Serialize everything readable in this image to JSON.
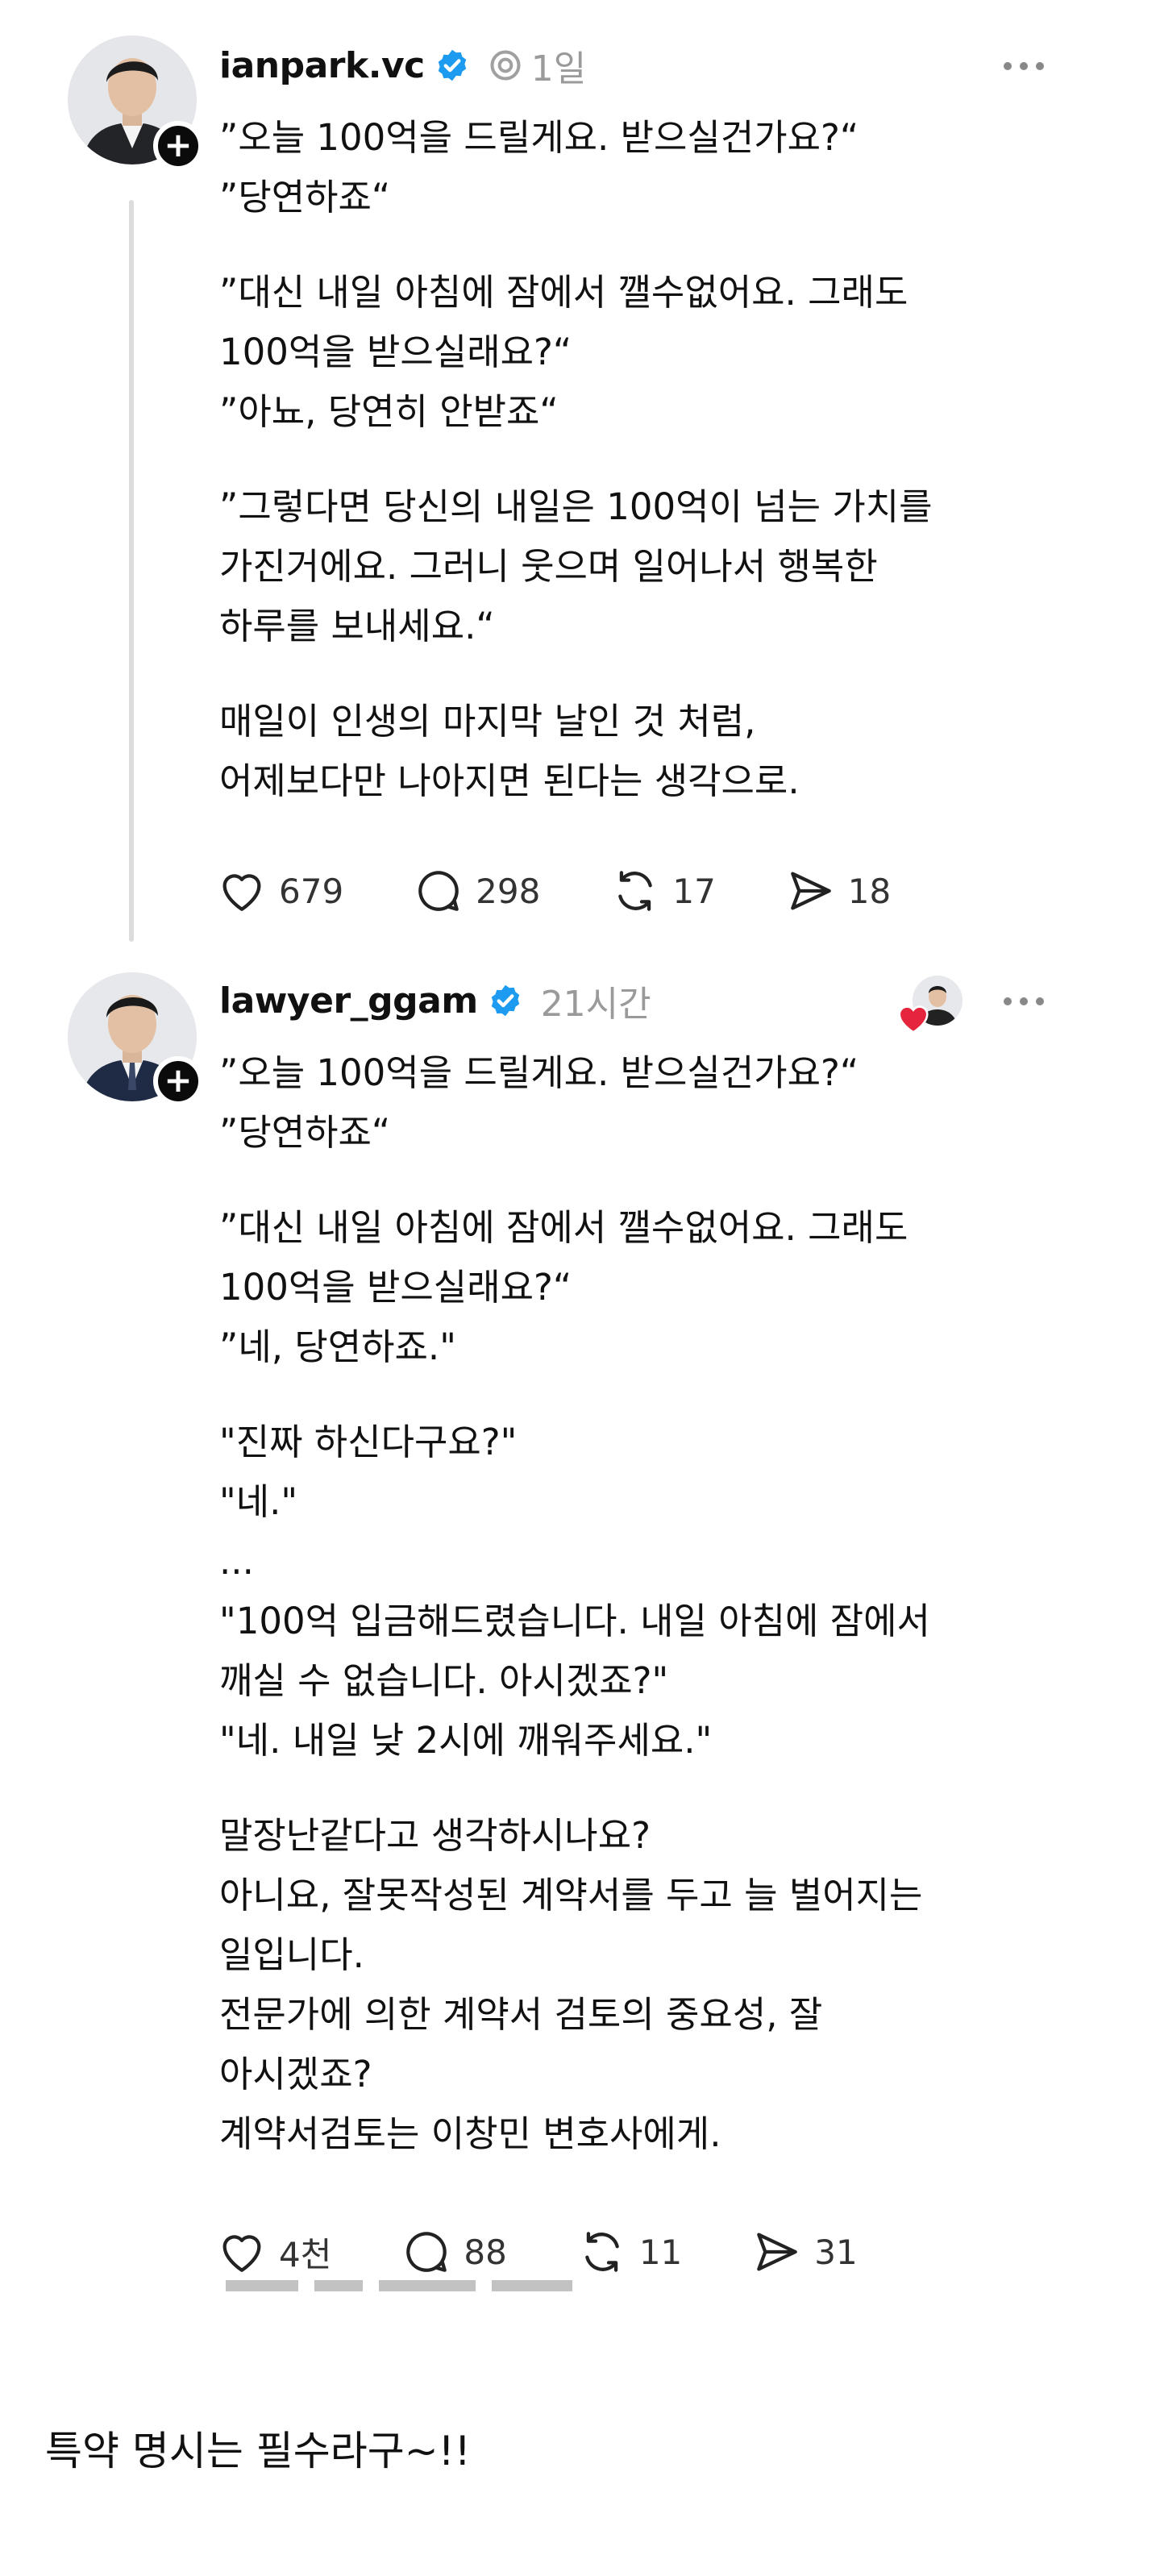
{
  "posts": [
    {
      "username": "ianpark.vc",
      "time": "1일",
      "paragraphs": [
        "”오늘 100억을 드릴게요. 받으실건가요?“\n”당연하죠“",
        "”대신 내일 아침에 잠에서 깰수없어요. 그래도\n100억을 받으실래요?“\n”아뇨, 당연히 안받죠“",
        "”그렇다면 당신의 내일은 100억이 넘는 가치를\n가진거에요. 그러니 웃으며 일어나서 행복한\n하루를 보내세요.“",
        "매일이 인생의 마지막 날인 것 처럼,\n어제보다만 나아지면 된다는 생각으로."
      ],
      "likes": "679",
      "replies": "298",
      "reposts": "17",
      "shares": "18"
    },
    {
      "username": "lawyer_ggam",
      "time": "21시간",
      "paragraphs": [
        "”오늘 100억을 드릴게요. 받으실건가요?“\n”당연하죠“",
        "”대신 내일 아침에 잠에서 깰수없어요. 그래도\n100억을 받으실래요?“\n”네, 당연하죠.\"",
        "\"진짜 하신다구요?\"\n\"네.\"\n...\n\"100억 입금해드렸습니다. 내일 아침에 잠에서\n깨실 수 없습니다. 아시겠죠?\"\n\"네. 내일 낮 2시에 깨워주세요.\"",
        "말장난같다고 생각하시나요?\n아니요, 잘못작성된 계약서를 두고 늘 벌어지는\n일입니다.\n전문가에 의한 계약서 검토의 중요성, 잘\n아시겠죠?\n계약서검토는 이창민 변호사에게."
      ],
      "likes": "4천",
      "replies": "88",
      "reposts": "11",
      "shares": "31"
    }
  ],
  "caption": "특약 명시는 필수라구~!!",
  "colors": {
    "verified": "#1d9bf0",
    "heart": "#e5253d",
    "muted": "#9a9a9a"
  }
}
